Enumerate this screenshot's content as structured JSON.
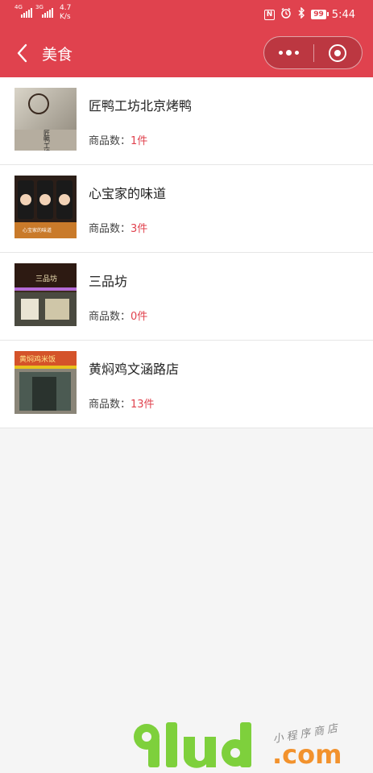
{
  "status_bar": {
    "net1": "4G",
    "net2": "3G",
    "speed_value": "4.7",
    "speed_unit": "K/s",
    "nfc_icon": "N",
    "battery": "99",
    "time": "5:44"
  },
  "nav": {
    "title": "美食"
  },
  "stores": [
    {
      "name": "匠鸭工坊北京烤鸭",
      "count_label": "商品数：",
      "count_value": "1件"
    },
    {
      "name": "心宝家的味道",
      "count_label": "商品数：",
      "count_value": "3件"
    },
    {
      "name": "三品坊",
      "count_label": "商品数：",
      "count_value": "0件"
    },
    {
      "name": "黄焖鸡文涵路店",
      "count_label": "商品数：",
      "count_value": "13件"
    }
  ],
  "thumb_texts": {
    "s1_sign": "匠鸭工坊",
    "s2_sign": "心宝家的味道",
    "s3_sign": "三品坊",
    "s4_sign": "黄焖鸡米饭"
  },
  "watermark": {
    "logo": "9lud",
    "tagline": "小程序商店",
    "domain": ".com"
  },
  "colors": {
    "header": "#e0424e",
    "accent": "#e0424e",
    "watermark_green": "#7ed03c",
    "watermark_orange": "#f2922d"
  },
  "icons": [
    "back-chevron-icon",
    "more-dots-icon",
    "close-target-icon",
    "nfc-icon",
    "alarm-icon",
    "bluetooth-icon",
    "battery-icon",
    "signal-icon"
  ]
}
